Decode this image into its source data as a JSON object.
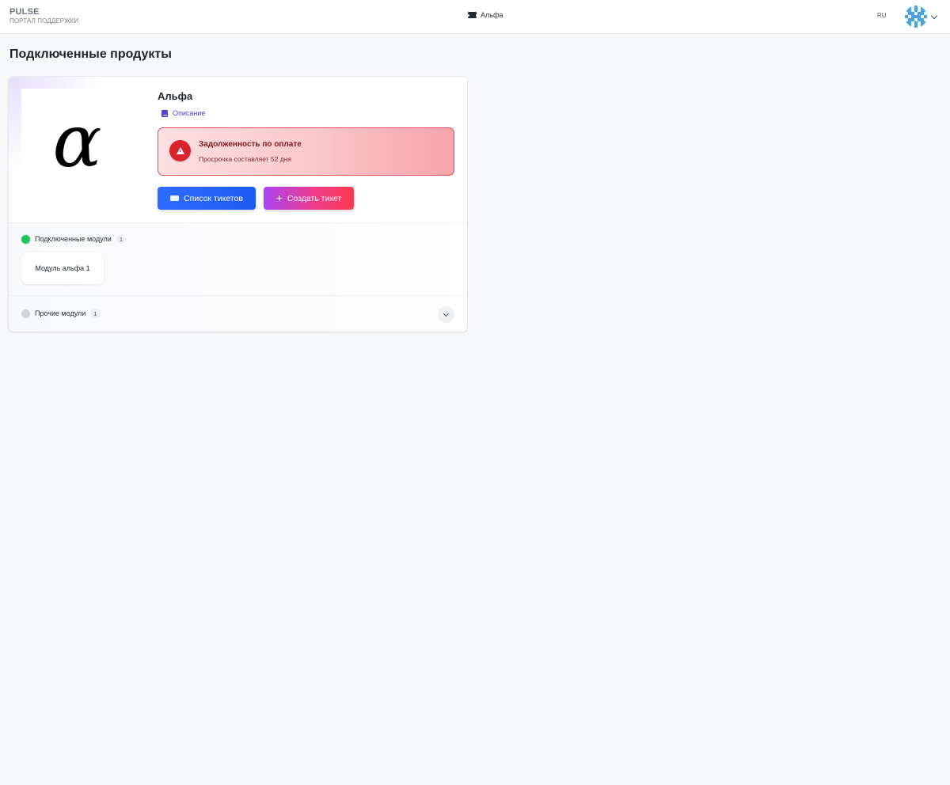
{
  "header": {
    "brand_name": "PULSE",
    "brand_subtitle": "ПОРТАЛ ПОДДЕРЖКИ",
    "current_product": "Альфа",
    "language": "RU"
  },
  "page": {
    "title": "Подключенные продукты"
  },
  "product": {
    "name": "Альфа",
    "logo_symbol": "α",
    "description_link": "Описание",
    "alert": {
      "title": "Задолженность по оплате",
      "text": "Просрочка составляет 52 дня"
    },
    "buttons": {
      "tickets": "Список тикетов",
      "create": "Создать тикет",
      "create_icon": "+"
    },
    "connected_modules": {
      "label": "Подключенные модули",
      "count": "1",
      "items": [
        "Модуль альфа 1"
      ]
    },
    "other_modules": {
      "label": "Прочие модули",
      "count": "1"
    }
  },
  "colors": {
    "accent_blue": "#1c5cf5",
    "alert_red": "#d9242f",
    "status_green": "#22c55e",
    "link_purple": "#4b3fd0"
  }
}
